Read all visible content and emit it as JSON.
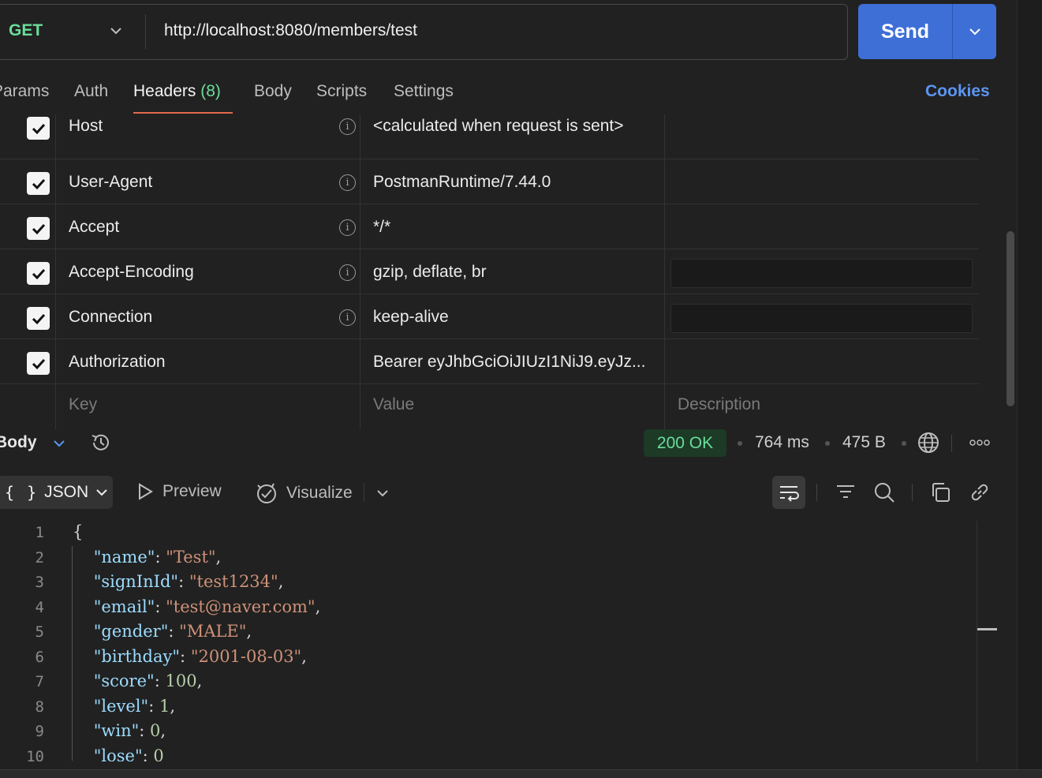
{
  "request": {
    "method": "GET",
    "url": "http://localhost:8080/members/test",
    "send_label": "Send"
  },
  "tabs": [
    {
      "label": "Params"
    },
    {
      "label": "Auth"
    },
    {
      "label": "Headers",
      "count": "(8)"
    },
    {
      "label": "Body"
    },
    {
      "label": "Scripts"
    },
    {
      "label": "Settings"
    }
  ],
  "cookies_label": "Cookies",
  "headers": [
    {
      "key": "Host",
      "value": "<calculated when request is sent>"
    },
    {
      "key": "User-Agent",
      "value": "PostmanRuntime/7.44.0"
    },
    {
      "key": "Accept",
      "value": "*/*"
    },
    {
      "key": "Accept-Encoding",
      "value": "gzip, deflate, br"
    },
    {
      "key": "Connection",
      "value": "keep-alive"
    },
    {
      "key": "Authorization",
      "value": "Bearer eyJhbGciOiJIUzI1NiJ9.eyJz..."
    }
  ],
  "header_placeholders": {
    "key": "Key",
    "value": "Value",
    "description": "Description"
  },
  "response": {
    "section_label": "Body",
    "status": "200 OK",
    "status_color": "#6bdd9a",
    "time": "764 ms",
    "size": "475 B",
    "format": "JSON",
    "format_braces": "{ }",
    "preview_label": "Preview",
    "visualize_label": "Visualize"
  },
  "code_lines": [
    {
      "n": "1",
      "text": "{"
    },
    {
      "n": "2",
      "key": "name",
      "value": "\"Test\"",
      "type": "s",
      "end": ","
    },
    {
      "n": "3",
      "key": "signInId",
      "value": "\"test1234\"",
      "type": "s",
      "end": ","
    },
    {
      "n": "4",
      "key": "email",
      "value": "\"test@naver.com\"",
      "type": "s",
      "end": ","
    },
    {
      "n": "5",
      "key": "gender",
      "value": "\"MALE\"",
      "type": "s",
      "end": ","
    },
    {
      "n": "6",
      "key": "birthday",
      "value": "\"2001-08-03\"",
      "type": "s",
      "end": ","
    },
    {
      "n": "7",
      "key": "score",
      "value": "100",
      "type": "n",
      "end": ","
    },
    {
      "n": "8",
      "key": "level",
      "value": "1",
      "type": "n",
      "end": ","
    },
    {
      "n": "9",
      "key": "win",
      "value": "0",
      "type": "n",
      "end": ","
    },
    {
      "n": "10",
      "key": "lose",
      "value": "0",
      "type": "n",
      "end": ""
    }
  ],
  "colors": {
    "accent": "#3e6fd7",
    "method_get": "#6bdd9a",
    "tab_underline": "#e2694b",
    "link": "#5b96f2"
  }
}
